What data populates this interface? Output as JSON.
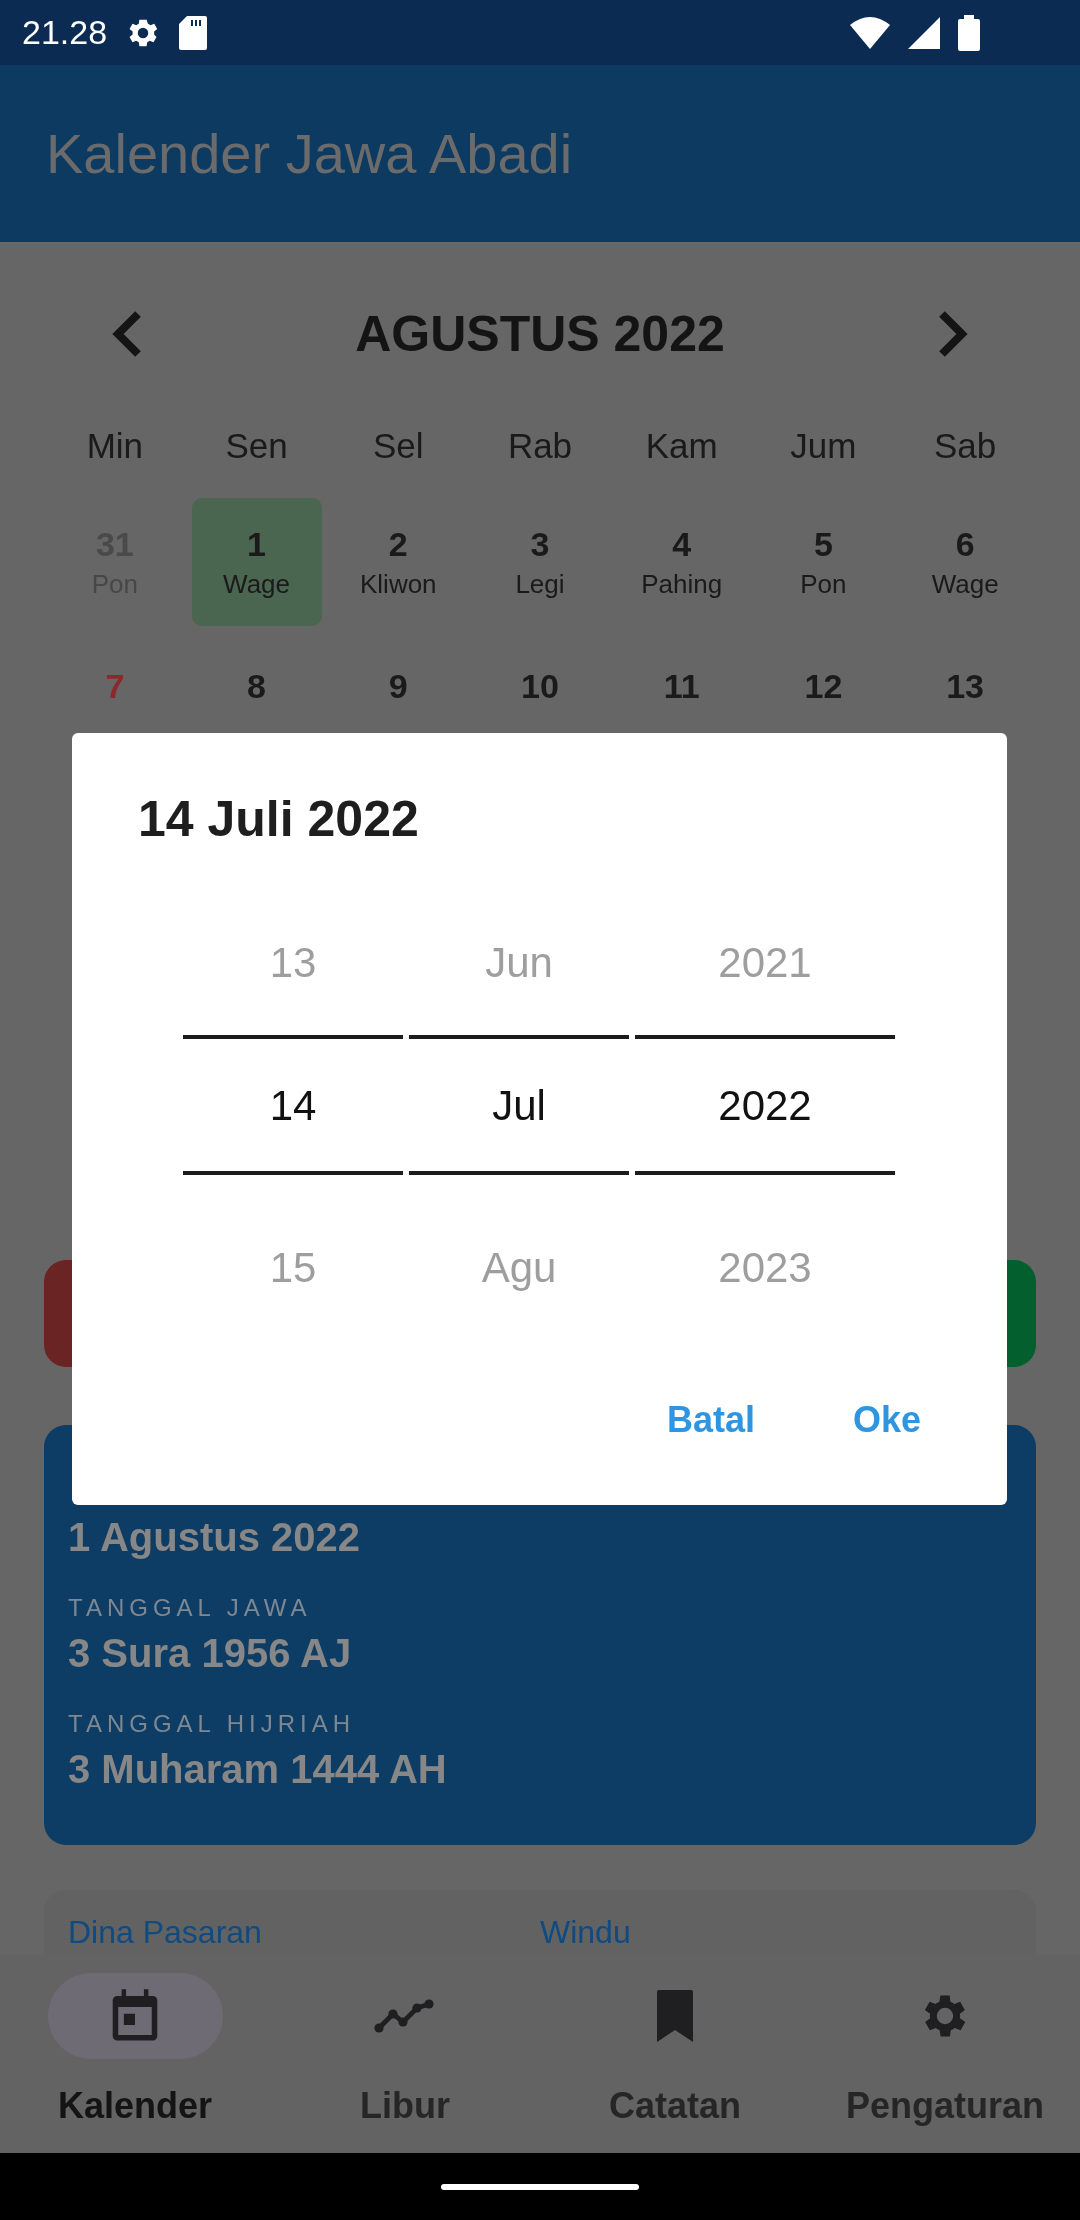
{
  "status_bar": {
    "time": "21.28"
  },
  "app_bar": {
    "title": "Kalender Jawa Abadi"
  },
  "calendar": {
    "month_title": "AGUSTUS 2022",
    "weekdays": [
      "Min",
      "Sen",
      "Sel",
      "Rab",
      "Kam",
      "Jum",
      "Sab"
    ],
    "weeks": [
      [
        {
          "day": "31",
          "pasaran": "Pon",
          "kind": "outside",
          "selected": false
        },
        {
          "day": "1",
          "pasaran": "Wage",
          "kind": "normal",
          "selected": true
        },
        {
          "day": "2",
          "pasaran": "Kliwon",
          "kind": "normal",
          "selected": false
        },
        {
          "day": "3",
          "pasaran": "Legi",
          "kind": "normal",
          "selected": false
        },
        {
          "day": "4",
          "pasaran": "Pahing",
          "kind": "normal",
          "selected": false
        },
        {
          "day": "5",
          "pasaran": "Pon",
          "kind": "normal",
          "selected": false
        },
        {
          "day": "6",
          "pasaran": "Wage",
          "kind": "normal",
          "selected": false
        }
      ],
      [
        {
          "day": "7",
          "kind": "holiday",
          "selected": false
        },
        {
          "day": "8",
          "kind": "normal",
          "selected": false
        },
        {
          "day": "9",
          "kind": "normal",
          "selected": false
        },
        {
          "day": "10",
          "kind": "normal",
          "selected": false
        },
        {
          "day": "11",
          "kind": "normal",
          "selected": false
        },
        {
          "day": "12",
          "kind": "normal",
          "selected": false
        },
        {
          "day": "13",
          "kind": "normal",
          "selected": false
        }
      ]
    ]
  },
  "summary_card": {
    "date": "1 Agustus 2022",
    "fields": [
      {
        "label": "TANGGAL JAWA",
        "value": "3 Sura 1956 AJ"
      },
      {
        "label": "TANGGAL HIJRIAH",
        "value": "3 Muharam 1444 AH"
      }
    ]
  },
  "info_card": {
    "labels": [
      "Dina Pasaran",
      "Windu"
    ]
  },
  "dialog": {
    "title": "14 Juli 2022",
    "columns": [
      {
        "above": "13",
        "value": "14",
        "below": "15"
      },
      {
        "above": "Jun",
        "value": "Jul",
        "below": "Agu"
      },
      {
        "above": "2021",
        "value": "2022",
        "below": "2023"
      }
    ],
    "buttons": [
      "Batal",
      "Oke"
    ]
  },
  "bottom_nav": [
    {
      "label": "Kalender",
      "selected": true
    },
    {
      "label": "Libur",
      "selected": false
    },
    {
      "label": "Catatan",
      "selected": false
    },
    {
      "label": "Pengaturan",
      "selected": false
    }
  ]
}
